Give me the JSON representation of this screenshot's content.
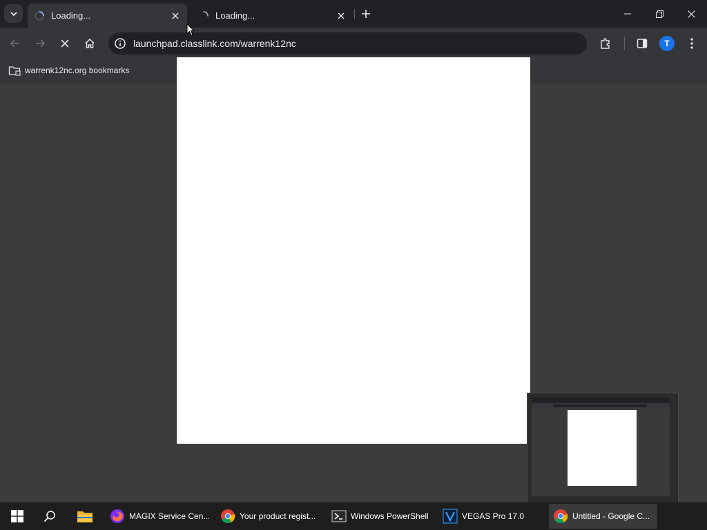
{
  "browser": {
    "tabs": [
      {
        "title": "Loading...",
        "active": true
      },
      {
        "title": "Loading...",
        "active": false
      }
    ],
    "address": "launchpad.classlink.com/warrenk12nc",
    "profile_initial": "T",
    "bookmarks": [
      {
        "label": "warrenk12nc.org bookmarks",
        "icon": "folder-icon"
      }
    ]
  },
  "taskbar": {
    "items": [
      {
        "label": "MAGIX Service Cen...",
        "icon": "firefox-icon"
      },
      {
        "label": "Your product regist...",
        "icon": "chrome-icon"
      },
      {
        "label": "Windows PowerShell",
        "icon": "powershell-icon"
      },
      {
        "label": "VEGAS Pro 17.0",
        "icon": "vegas-icon"
      },
      {
        "label": "Untitled - Google C...",
        "icon": "chrome-icon",
        "active": true
      }
    ]
  },
  "colors": {
    "frame": "#202124",
    "toolbar": "#35363a",
    "content_bg": "#3c3c3c",
    "profile": "#1a73e8",
    "taskbar": "#1e1e1e",
    "taskbar_accent": "#76b9ed"
  }
}
